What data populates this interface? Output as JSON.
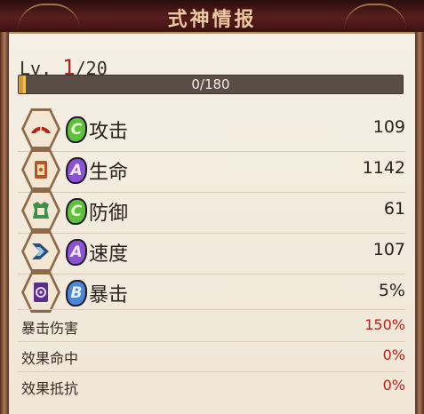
{
  "header": {
    "title": "式神情报"
  },
  "level": {
    "prefix": "Lv.",
    "current": "1",
    "max": "/20"
  },
  "xp": {
    "text": "0/180",
    "progress": 0.0
  },
  "stats": [
    {
      "icon": "attack-fan-icon",
      "grade": "C",
      "name": "攻击",
      "value": "109"
    },
    {
      "icon": "health-scroll-icon",
      "grade": "A",
      "name": "生命",
      "value": "1142"
    },
    {
      "icon": "defense-armor-icon",
      "grade": "C",
      "name": "防御",
      "value": "61"
    },
    {
      "icon": "speed-chevron-icon",
      "grade": "A",
      "name": "速度",
      "value": "107"
    },
    {
      "icon": "crit-rune-icon",
      "grade": "B",
      "name": "暴击",
      "value": "5%"
    }
  ],
  "substats": [
    {
      "name": "暴击伤害",
      "value": "150%"
    },
    {
      "name": "效果命中",
      "value": "0%"
    },
    {
      "name": "效果抵抗",
      "value": "0%"
    }
  ],
  "colors": {
    "grade_C": "#5ec13a",
    "grade_A": "#8b52d6",
    "grade_B": "#4a86d9",
    "accent_red": "#b4231d"
  }
}
